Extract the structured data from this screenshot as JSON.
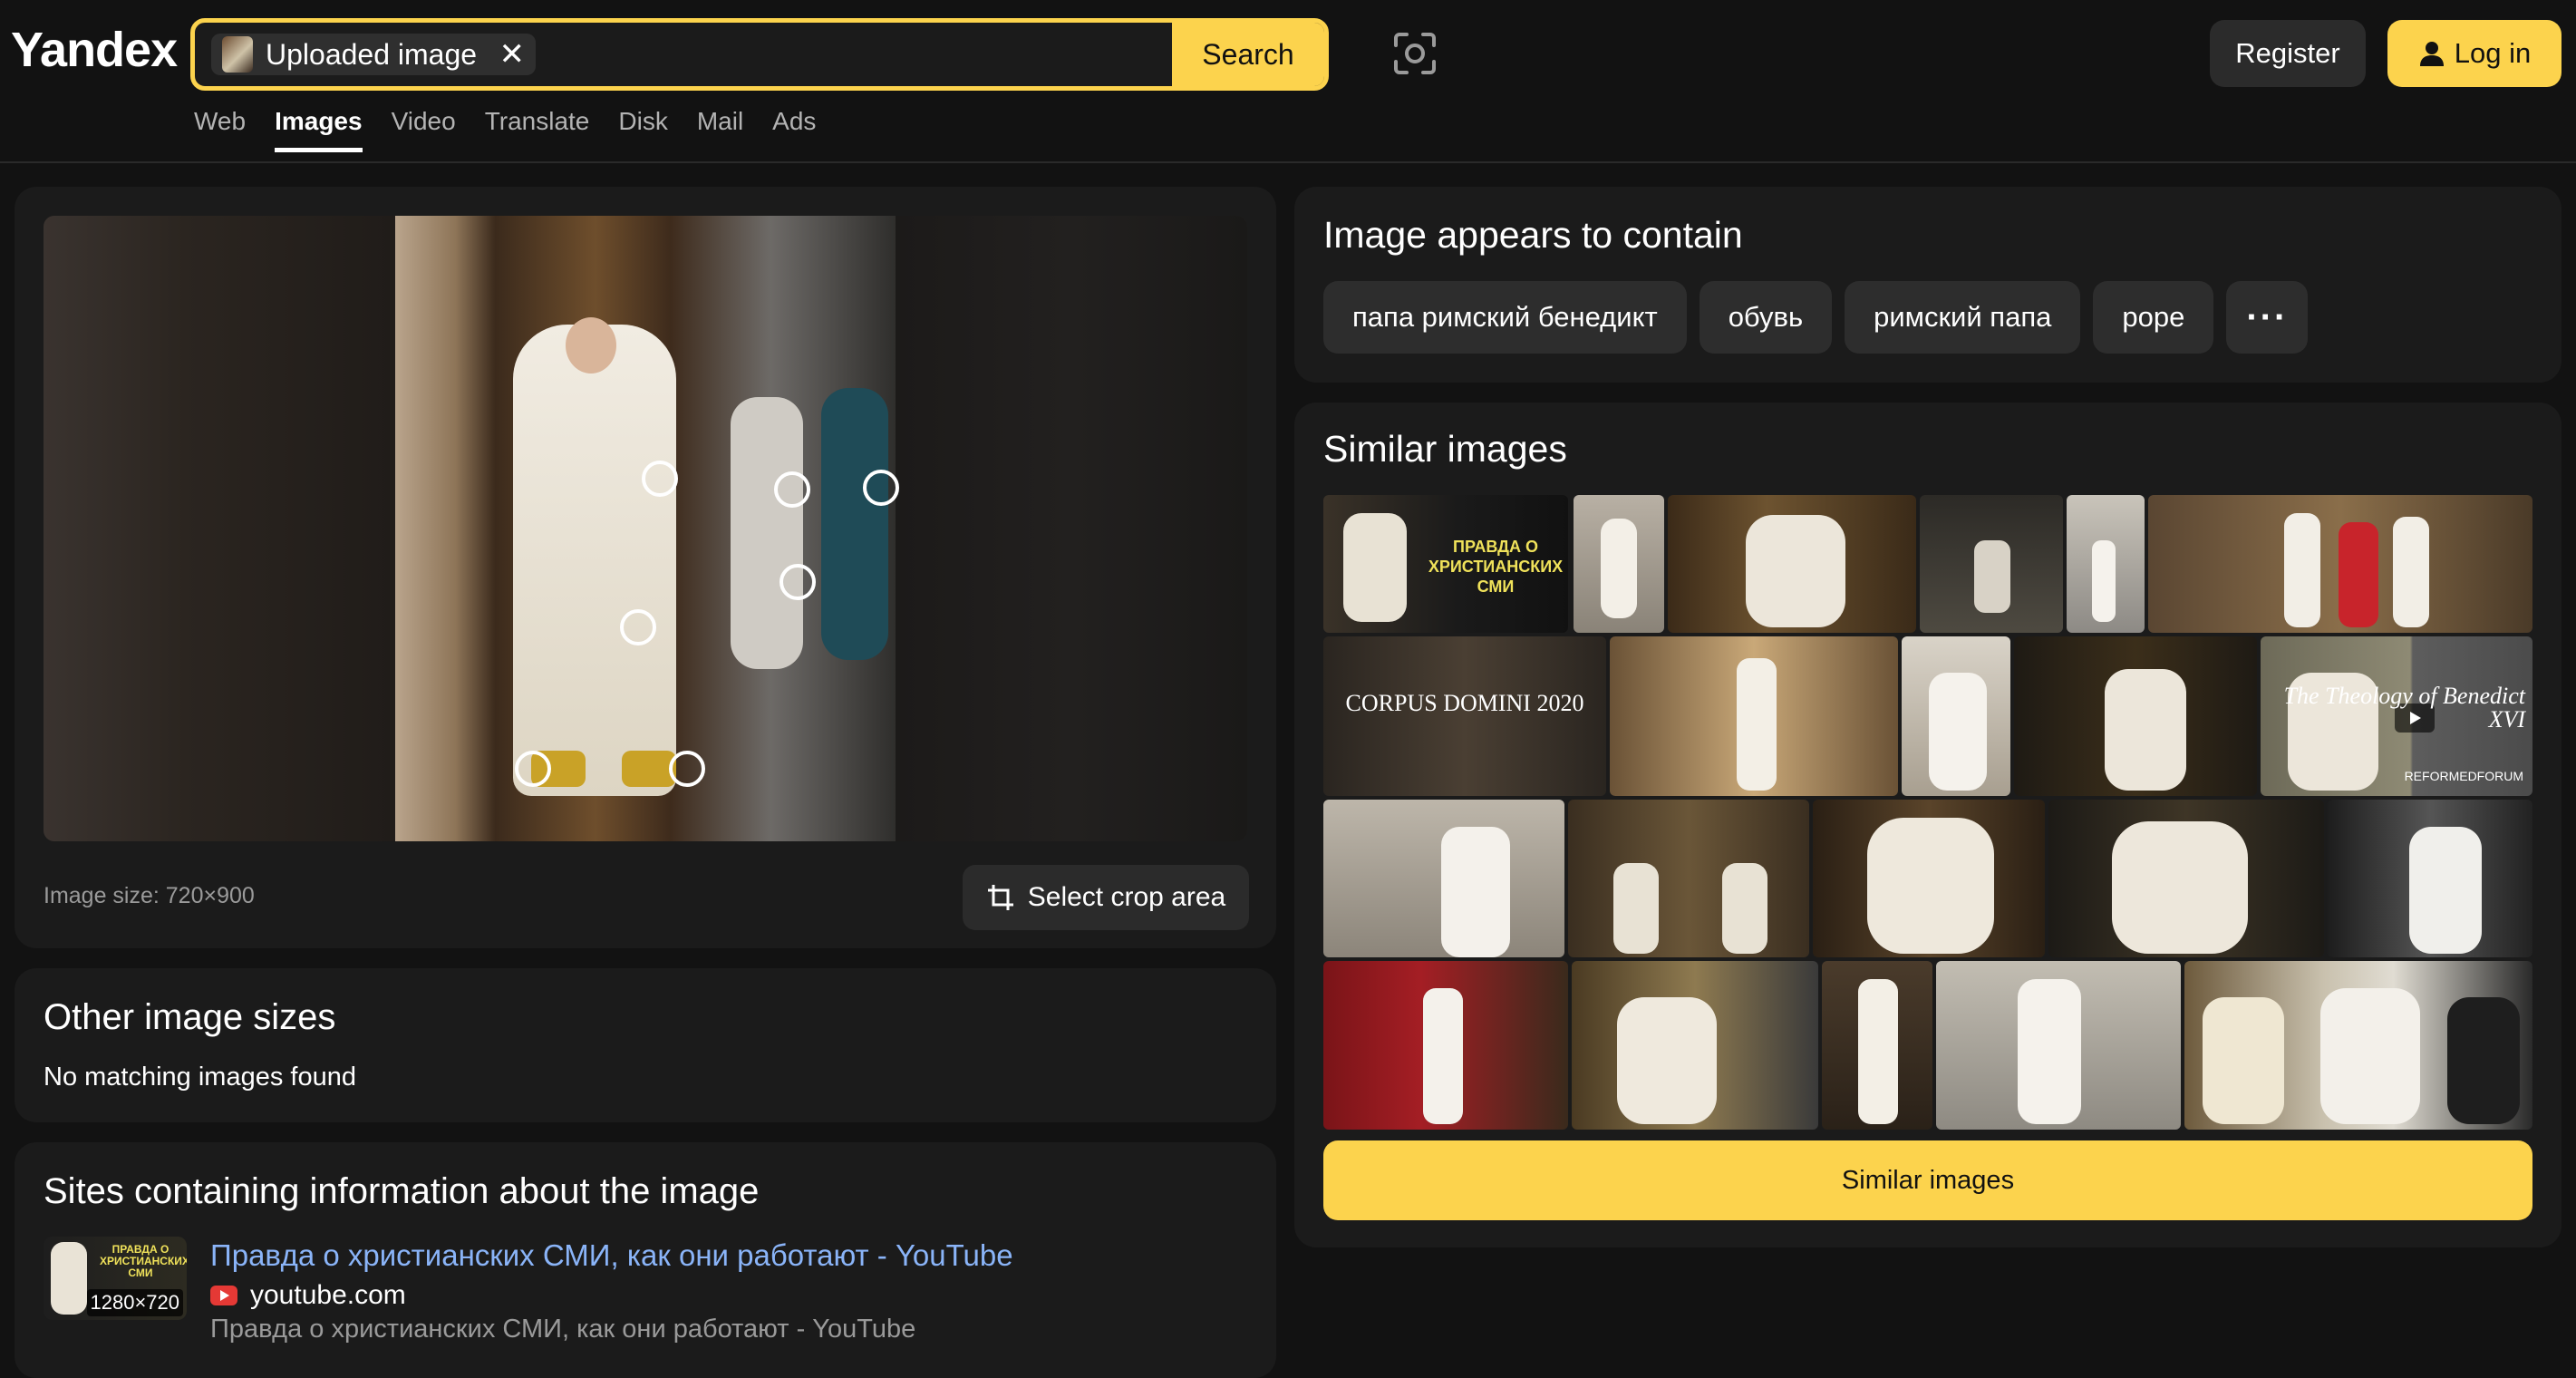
{
  "header": {
    "logo": "Yandex",
    "search_chip_label": "Uploaded image",
    "search_chip_clear": "✕",
    "search_button": "Search",
    "register": "Register",
    "login": "Log in",
    "tabs": [
      {
        "label": "Web"
      },
      {
        "label": "Images",
        "active": true
      },
      {
        "label": "Video"
      },
      {
        "label": "Translate"
      },
      {
        "label": "Disk"
      },
      {
        "label": "Mail"
      },
      {
        "label": "Ads"
      }
    ]
  },
  "preview": {
    "image_size": "Image size: 720×900",
    "crop_button": "Select crop area"
  },
  "other_sizes": {
    "title": "Other image sizes",
    "text": "No matching images found"
  },
  "sites": {
    "title": "Sites containing information about the image",
    "items": [
      {
        "link": "Правда о христианских СМИ, как они работают - YouTube",
        "domain": "youtube.com",
        "description": "Правда о христианских СМИ, как они работают - YouTube",
        "resolution": "1280×720",
        "thumb_caption": "ПРАВДА О ХРИСТИАНСКИХ СМИ"
      }
    ]
  },
  "contains": {
    "title": "Image appears to contain",
    "tags": [
      "папа римский бенедикт",
      "обувь",
      "римский папа",
      "pope"
    ],
    "more": "···"
  },
  "similar": {
    "title": "Similar images",
    "button": "Similar images",
    "captions": {
      "pravda": "ПРАВДА О ХРИСТИАНСКИХ СМИ",
      "corpus": "CORPUS DOMINI 2020",
      "theology": "The Theology of Benedict XVI",
      "reformed": "REFORMEDFORUM"
    }
  },
  "colors": {
    "accent": "#fcd34d",
    "background": "#121212",
    "panel": "#1b1b1b",
    "link": "#8ab4f8"
  },
  "icons": [
    "image-search-lens-icon",
    "user-icon",
    "crop-icon",
    "youtube-icon",
    "more-dots-icon",
    "play-icon"
  ]
}
